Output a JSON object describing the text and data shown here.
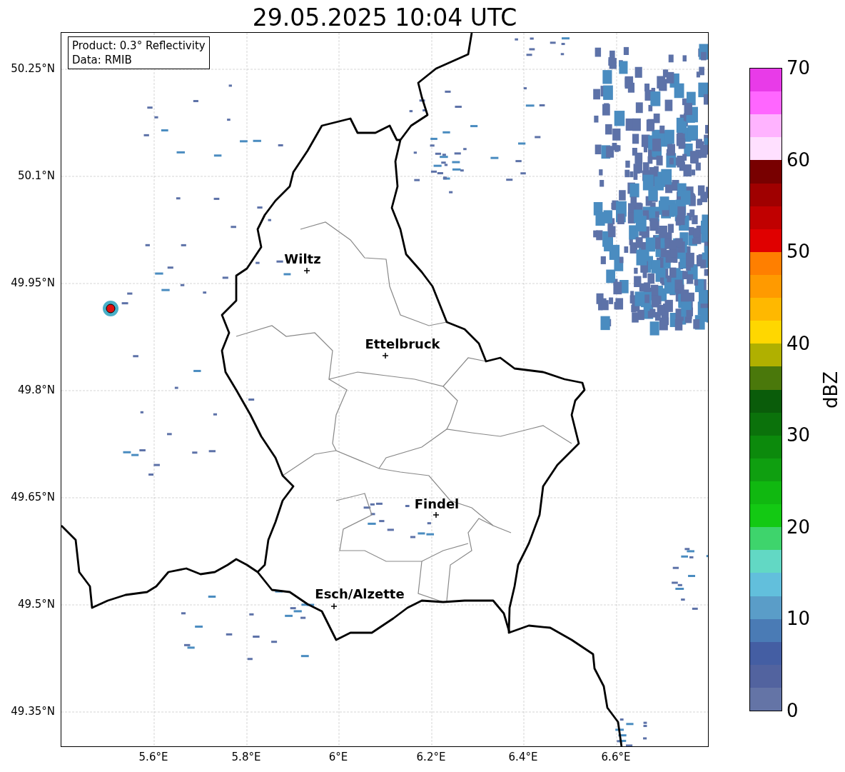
{
  "title": "29.05.2025 10:04 UTC",
  "legend": [
    "Product: 0.3° Reflectivity",
    "Data: RMIB"
  ],
  "lat_ticks": [
    "50.25°N",
    "50.1°N",
    "49.95°N",
    "49.8°N",
    "49.65°N",
    "49.5°N",
    "49.35°N"
  ],
  "lon_ticks": [
    "5.6°E",
    "5.8°E",
    "6°E",
    "6.2°E",
    "6.4°E",
    "6.6°E"
  ],
  "cities": [
    {
      "name": "Wiltz"
    },
    {
      "name": "Ettelbruck"
    },
    {
      "name": "Findel"
    },
    {
      "name": "Esch/Alzette"
    }
  ],
  "colorbar": {
    "label": "dBZ",
    "ticks": [
      "70",
      "60",
      "50",
      "40",
      "30",
      "20",
      "10",
      "0"
    ],
    "segments": [
      {
        "color": "#6474a6"
      },
      {
        "color": "#52639f"
      },
      {
        "color": "#445ea3"
      },
      {
        "color": "#4a7bb5"
      },
      {
        "color": "#5a9dc8"
      },
      {
        "color": "#62bfdc"
      },
      {
        "color": "#62d8c4"
      },
      {
        "color": "#3ed46c"
      },
      {
        "color": "#13c913"
      },
      {
        "color": "#10b810"
      },
      {
        "color": "#0f9f10"
      },
      {
        "color": "#0c8a0c"
      },
      {
        "color": "#0b720b"
      },
      {
        "color": "#0a5c0a"
      },
      {
        "color": "#4a780b"
      },
      {
        "color": "#b0b000"
      },
      {
        "color": "#ffd700"
      },
      {
        "color": "#ffb800"
      },
      {
        "color": "#ff9a00"
      },
      {
        "color": "#ff7f00"
      },
      {
        "color": "#e00000"
      },
      {
        "color": "#c00000"
      },
      {
        "color": "#a00000"
      },
      {
        "color": "#780000"
      },
      {
        "color": "#ffe0ff"
      },
      {
        "color": "#ffb3ff"
      },
      {
        "color": "#ff66ff"
      },
      {
        "color": "#e83be8"
      }
    ]
  }
}
